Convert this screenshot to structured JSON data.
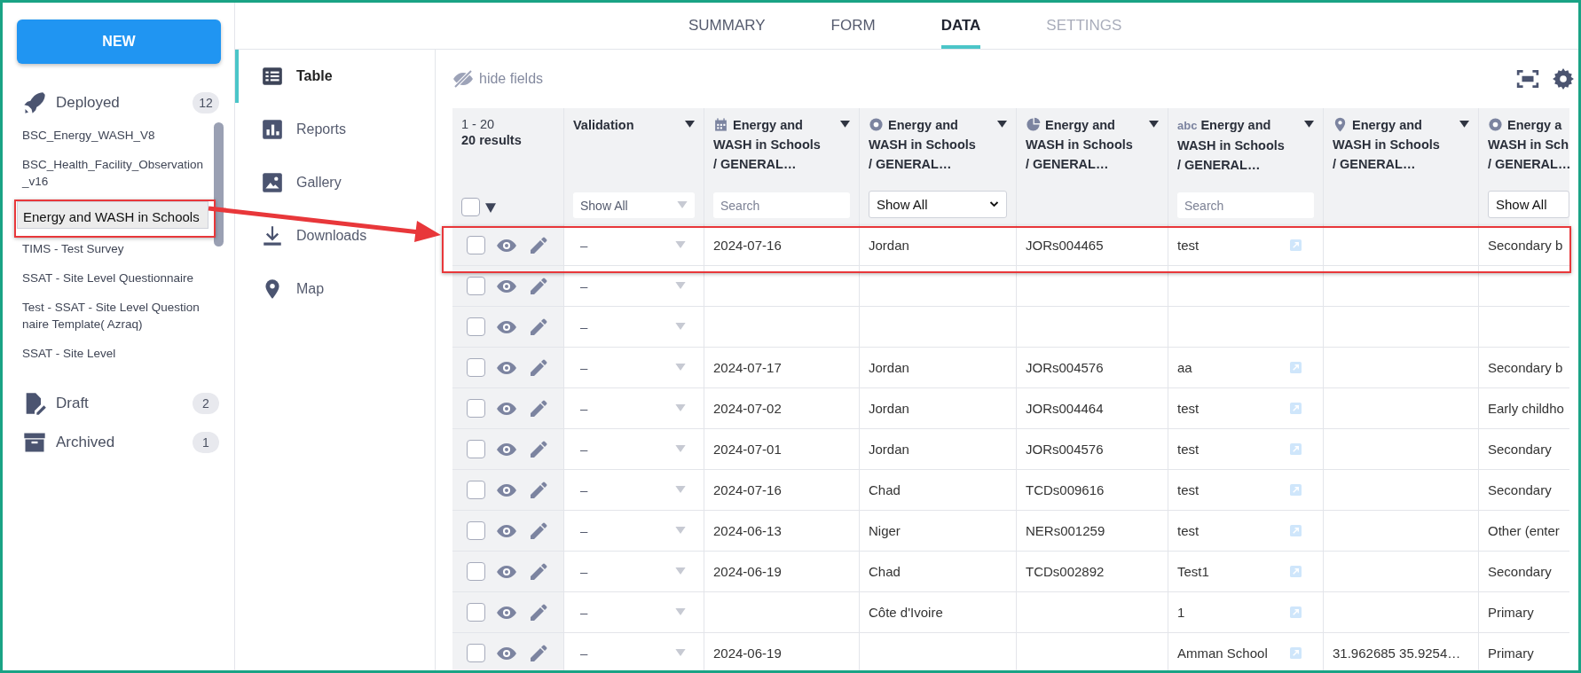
{
  "sidebar": {
    "new_button": "NEW",
    "sections": [
      {
        "kind": "deployed",
        "label": "Deployed",
        "count": "12",
        "items": [
          {
            "label": "BSC_Energy_WASH_V8",
            "selected": false
          },
          {
            "label": "BSC_Health_Facility_Observation_v16",
            "selected": false
          },
          {
            "label": "Energy and WASH in Schools",
            "selected": true
          },
          {
            "label": "TIMS - Test Survey",
            "selected": false
          },
          {
            "label": "SSAT - Site Level Questionnaire",
            "selected": false
          },
          {
            "label": "Test - SSAT - Site Level Questionnaire Template( Azraq)",
            "selected": false
          },
          {
            "label": "SSAT - Site Level",
            "selected": false
          }
        ]
      },
      {
        "kind": "draft",
        "label": "Draft",
        "count": "2"
      },
      {
        "kind": "archived",
        "label": "Archived",
        "count": "1"
      }
    ]
  },
  "tabs": [
    {
      "label": "SUMMARY",
      "selected": false,
      "disabled": false
    },
    {
      "label": "FORM",
      "selected": false,
      "disabled": false
    },
    {
      "label": "DATA",
      "selected": true,
      "disabled": false
    },
    {
      "label": "SETTINGS",
      "selected": false,
      "disabled": true
    }
  ],
  "subnav": [
    {
      "kind": "table",
      "label": "Table",
      "selected": true
    },
    {
      "kind": "reports",
      "label": "Reports",
      "selected": false
    },
    {
      "kind": "gallery",
      "label": "Gallery",
      "selected": false
    },
    {
      "kind": "downloads",
      "label": "Downloads",
      "selected": false
    },
    {
      "kind": "map",
      "label": "Map",
      "selected": false
    }
  ],
  "toolbar": {
    "hide_fields": "hide fields"
  },
  "table": {
    "range": "1 - 20",
    "results": "20 results",
    "select_all": {
      "checked": false
    },
    "columns": [
      {
        "title": [
          "Validation"
        ],
        "filter": {
          "kind": "dropdown",
          "value": "Show All"
        }
      },
      {
        "title": [
          "Energy and",
          "WASH in Schools",
          "/ GENERAL…"
        ],
        "filter": {
          "kind": "search",
          "placeholder": "Search"
        }
      },
      {
        "title": [
          "Energy and",
          "WASH in Schools",
          "/ GENERAL…"
        ],
        "filter": {
          "kind": "select",
          "value": "Show All"
        }
      },
      {
        "title": [
          "Energy and",
          "WASH in Schools",
          "/ GENERAL…"
        ],
        "filter": {
          "kind": "none"
        }
      },
      {
        "type_label": "abc",
        "title": [
          "Energy and",
          "WASH in Schools",
          "/ GENERAL…"
        ],
        "filter": {
          "kind": "search",
          "placeholder": "Search"
        }
      },
      {
        "title": [
          "Energy and",
          "WASH in Schools",
          "/ GENERAL…"
        ],
        "filter": {
          "kind": "none"
        }
      },
      {
        "title": [
          "Energy a",
          "WASH in Sch",
          "/ GENERAL…"
        ],
        "filter": {
          "kind": "select",
          "value": "Show All"
        }
      }
    ],
    "rows": [
      {
        "checked": false,
        "validation": "–",
        "date": "2024-07-16",
        "country": "Jordan",
        "id": "JORs004465",
        "text": "test",
        "geo": "",
        "level": "Secondary b"
      },
      {
        "checked": false,
        "validation": "–",
        "date": "",
        "country": "",
        "id": "",
        "text": "",
        "geo": "",
        "level": ""
      },
      {
        "checked": false,
        "validation": "–",
        "date": "",
        "country": "",
        "id": "",
        "text": "",
        "geo": "",
        "level": ""
      },
      {
        "checked": false,
        "validation": "–",
        "date": "2024-07-17",
        "country": "Jordan",
        "id": "JORs004576",
        "text": "aa",
        "geo": "",
        "level": "Secondary b"
      },
      {
        "checked": false,
        "validation": "–",
        "date": "2024-07-02",
        "country": "Jordan",
        "id": "JORs004464",
        "text": "test",
        "geo": "",
        "level": "Early childho"
      },
      {
        "checked": false,
        "validation": "–",
        "date": "2024-07-01",
        "country": "Jordan",
        "id": "JORs004576",
        "text": "test",
        "geo": "",
        "level": "Secondary"
      },
      {
        "checked": false,
        "validation": "–",
        "date": "2024-07-16",
        "country": "Chad",
        "id": "TCDs009616",
        "text": "test",
        "geo": "",
        "level": "Secondary"
      },
      {
        "checked": false,
        "validation": "–",
        "date": "2024-06-13",
        "country": "Niger",
        "id": "NERs001259",
        "text": "test",
        "geo": "",
        "level": "Other (enter"
      },
      {
        "checked": false,
        "validation": "–",
        "date": "2024-06-19",
        "country": "Chad",
        "id": "TCDs002892",
        "text": "Test1",
        "geo": "",
        "level": "Secondary"
      },
      {
        "checked": false,
        "validation": "–",
        "date": "",
        "country": "Côte d'Ivoire",
        "id": "",
        "text": "1",
        "geo": "",
        "level": "Primary"
      },
      {
        "checked": false,
        "validation": "–",
        "date": "2024-06-19",
        "country": "",
        "id": "",
        "text": "Amman School",
        "geo": "31.962685 35.9254…",
        "level": "Primary"
      }
    ]
  }
}
